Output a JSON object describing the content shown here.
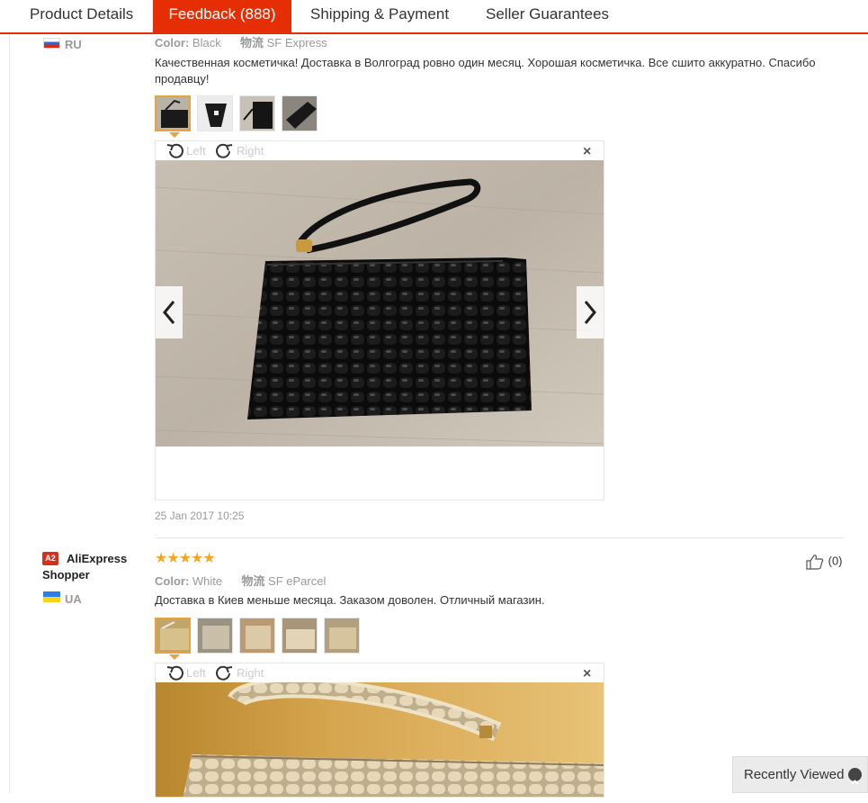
{
  "tabs": [
    {
      "label": "Product Details"
    },
    {
      "label": "Feedback (888)"
    },
    {
      "label": "Shipping & Payment"
    },
    {
      "label": "Seller Guarantees"
    }
  ],
  "reviews": [
    {
      "country": "RU",
      "color_label": "Color:",
      "color_value": "Black",
      "ship_label": "物流",
      "ship_value": "SF Express",
      "comment": "Качественная косметичка! Доставка в Волгоград ровно один месяц. Хорошая косметичка. Все сшито аккуратно. Спасибо продавцу!",
      "rotate_left": "Left",
      "rotate_right": "Right",
      "close": "×",
      "date": "25 Jan 2017 10:25"
    },
    {
      "badge": "A2",
      "user": "AliExpress Shopper",
      "country": "UA",
      "stars": "★★★★★",
      "rating": 5,
      "color_label": "Color:",
      "color_value": "White",
      "ship_label": "物流",
      "ship_value": "SF eParcel",
      "helpful_count": "(0)",
      "comment": "Доставка в Киев меньше месяца. Заказом доволен. Отличный магазин.",
      "rotate_left": "Left",
      "rotate_right": "Right",
      "close": "×"
    }
  ],
  "recently_viewed": "Recently Viewed",
  "colors": {
    "accent": "#e62e04",
    "thumb_selected": "#e8a33c",
    "stars": "#f5a623",
    "badge": "#d6311c"
  }
}
